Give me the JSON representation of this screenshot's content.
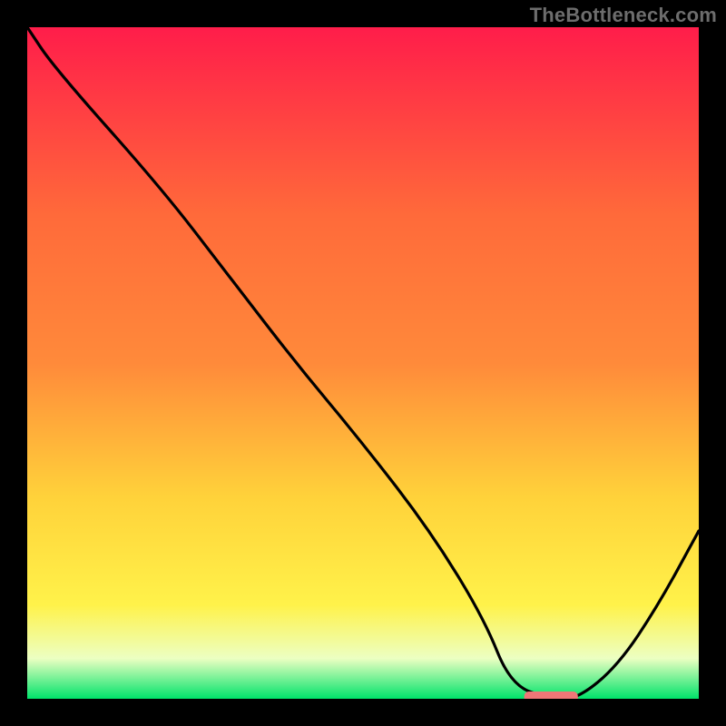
{
  "watermark": "TheBottleneck.com",
  "colors": {
    "bg": "#000000",
    "curve": "#000000",
    "marker_fill": "#ef7677",
    "grad_top": "#ff1d4a",
    "grad_mid1": "#ff8a3a",
    "grad_mid2": "#ffd23a",
    "grad_mid3": "#fff24a",
    "grad_mid4": "#f8ffa0",
    "grad_bottom": "#00e36a",
    "watermark": "#6d6d6d"
  },
  "chart_data": {
    "type": "line",
    "title": "",
    "xlabel": "",
    "ylabel": "",
    "xlim": [
      0,
      100
    ],
    "ylim": [
      0,
      100
    ],
    "x": [
      0,
      4,
      20,
      30,
      40,
      50,
      60,
      68,
      72,
      78,
      82,
      88,
      94,
      100
    ],
    "y": [
      100,
      94,
      76,
      63,
      50,
      38,
      25,
      12,
      2,
      0,
      0,
      5,
      14,
      25
    ],
    "marker": {
      "x_start": 74,
      "x_end": 82,
      "y": 0
    },
    "grid": false,
    "legend": false
  }
}
